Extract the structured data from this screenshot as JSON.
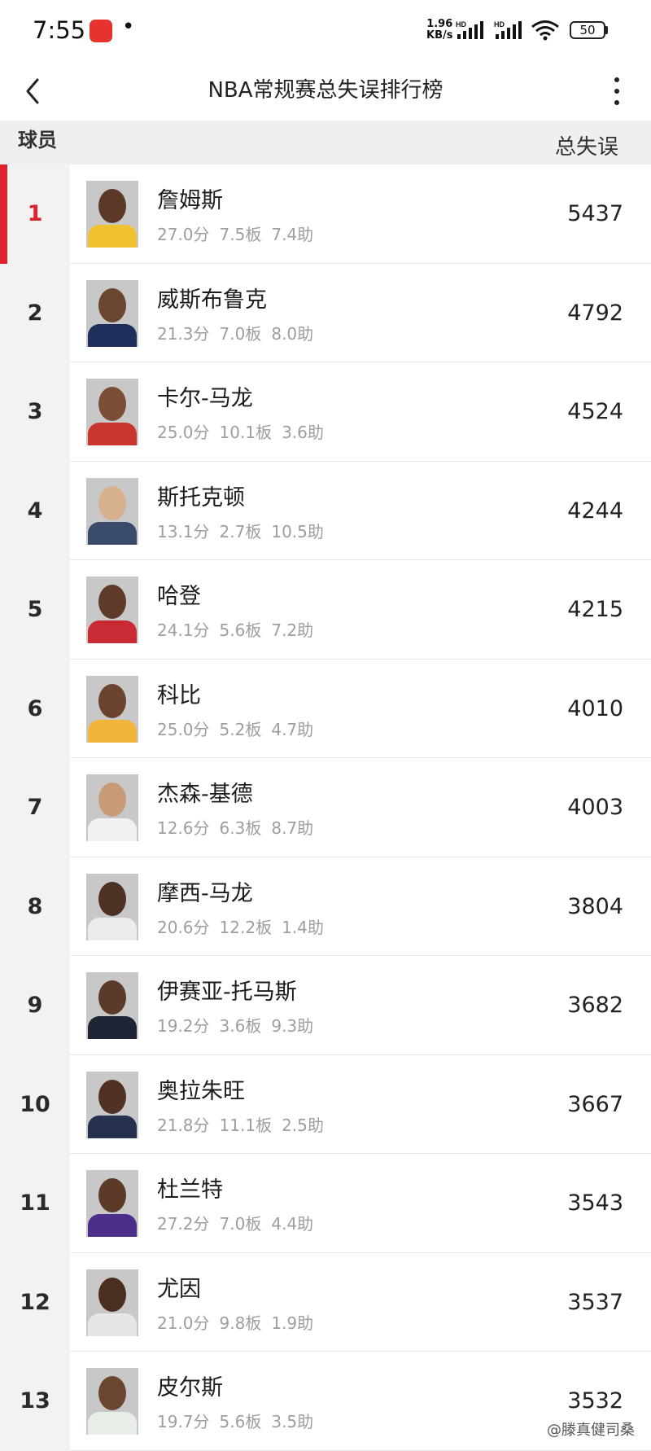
{
  "status_bar": {
    "time": "7:55",
    "dot": "•",
    "net_speed_value": "1.96",
    "net_speed_unit": "KB/s",
    "battery": "50",
    "icons": [
      "app-notification-icon",
      "signal-hd-icon",
      "signal-hd-icon",
      "wifi-icon",
      "battery-icon"
    ]
  },
  "nav": {
    "title": "NBA常规赛总失误排行榜",
    "icons": [
      "back-chevron-icon",
      "more-vertical-icon"
    ]
  },
  "header": {
    "player_label": "球员",
    "turnovers_label": "总失误"
  },
  "colors": {
    "accent": "#e0202a",
    "rank_column_bg": "#f2f2f2",
    "header_bg": "#efefef",
    "stats_text": "#9e9e9e"
  },
  "players": [
    {
      "rank": "1",
      "name": "詹姆斯",
      "pts": "27.0分",
      "reb": "7.5板",
      "ast": "7.4助",
      "turnovers": "5437",
      "head": "#5a3a26",
      "jersey": "#f0c231"
    },
    {
      "rank": "2",
      "name": "威斯布鲁克",
      "pts": "21.3分",
      "reb": "7.0板",
      "ast": "8.0助",
      "turnovers": "4792",
      "head": "#6a4530",
      "jersey": "#1f2f5c"
    },
    {
      "rank": "3",
      "name": "卡尔-马龙",
      "pts": "25.0分",
      "reb": "10.1板",
      "ast": "3.6助",
      "turnovers": "4524",
      "head": "#7a4e35",
      "jersey": "#c9362e"
    },
    {
      "rank": "4",
      "name": "斯托克顿",
      "pts": "13.1分",
      "reb": "2.7板",
      "ast": "10.5助",
      "turnovers": "4244",
      "head": "#d7b08e",
      "jersey": "#3a4a6a"
    },
    {
      "rank": "5",
      "name": "哈登",
      "pts": "24.1分",
      "reb": "5.6板",
      "ast": "7.2助",
      "turnovers": "4215",
      "head": "#5e3b28",
      "jersey": "#c92a34"
    },
    {
      "rank": "6",
      "name": "科比",
      "pts": "25.0分",
      "reb": "5.2板",
      "ast": "4.7助",
      "turnovers": "4010",
      "head": "#6b4430",
      "jersey": "#f2b43a"
    },
    {
      "rank": "7",
      "name": "杰森-基德",
      "pts": "12.6分",
      "reb": "6.3板",
      "ast": "8.7助",
      "turnovers": "4003",
      "head": "#c99a78",
      "jersey": "#f1f1f1"
    },
    {
      "rank": "8",
      "name": "摩西-马龙",
      "pts": "20.6分",
      "reb": "12.2板",
      "ast": "1.4助",
      "turnovers": "3804",
      "head": "#4d3122",
      "jersey": "#ececec"
    },
    {
      "rank": "9",
      "name": "伊赛亚-托马斯",
      "pts": "19.2分",
      "reb": "3.6板",
      "ast": "9.3助",
      "turnovers": "3682",
      "head": "#5a3a28",
      "jersey": "#1e2433"
    },
    {
      "rank": "10",
      "name": "奥拉朱旺",
      "pts": "21.8分",
      "reb": "11.1板",
      "ast": "2.5助",
      "turnovers": "3667",
      "head": "#4f3223",
      "jersey": "#26314f"
    },
    {
      "rank": "11",
      "name": "杜兰特",
      "pts": "27.2分",
      "reb": "7.0板",
      "ast": "4.4助",
      "turnovers": "3543",
      "head": "#5b3a28",
      "jersey": "#4b2f8a"
    },
    {
      "rank": "12",
      "name": "尤因",
      "pts": "21.0分",
      "reb": "9.8板",
      "ast": "1.9助",
      "turnovers": "3537",
      "head": "#4a2e20",
      "jersey": "#e6e6e6"
    },
    {
      "rank": "13",
      "name": "皮尔斯",
      "pts": "19.7分",
      "reb": "5.6板",
      "ast": "3.5助",
      "turnovers": "3532",
      "head": "#6a4530",
      "jersey": "#e8efe8"
    }
  ],
  "watermark": "@滕真健司桑"
}
